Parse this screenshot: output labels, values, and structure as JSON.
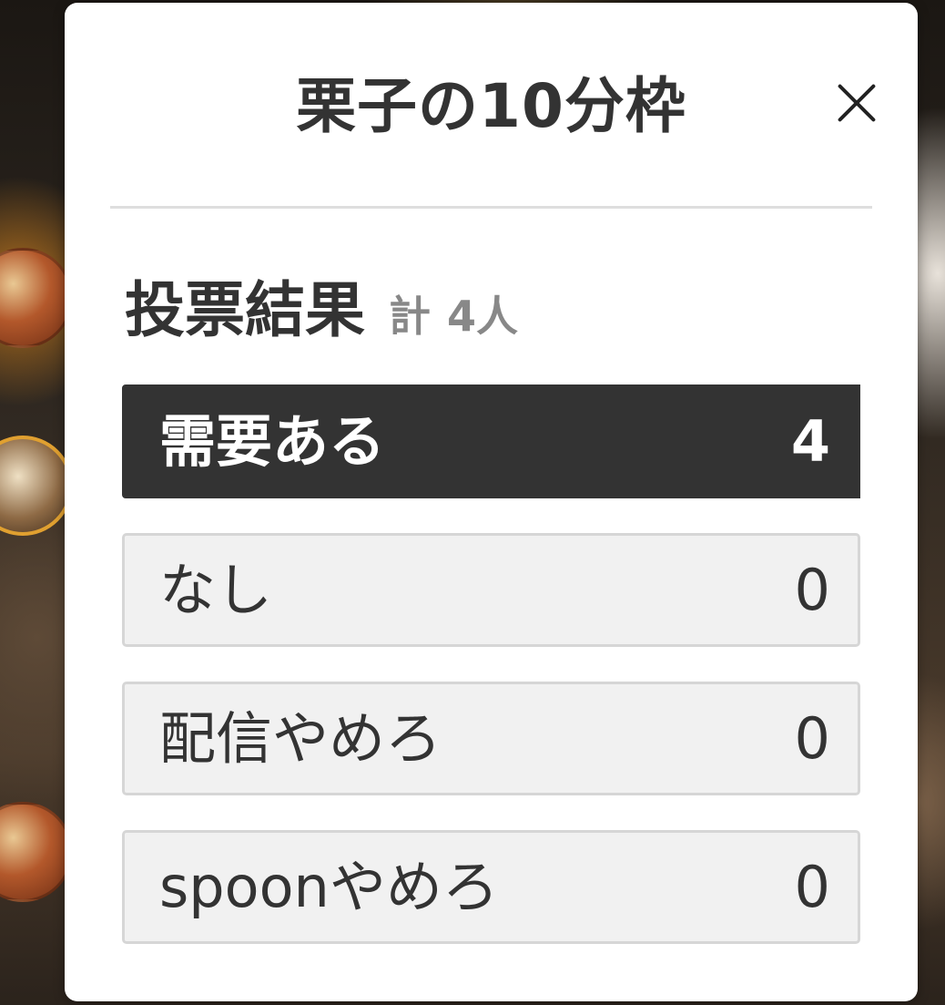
{
  "modal": {
    "title": "栗子の10分枠",
    "close_icon": "close-icon"
  },
  "results": {
    "heading": "投票結果",
    "total_prefix": "計",
    "total_count": "4人"
  },
  "options": [
    {
      "label": "需要ある",
      "count": "4",
      "highlighted": true
    },
    {
      "label": "なし",
      "count": "0",
      "highlighted": false
    },
    {
      "label": "配信やめろ",
      "count": "0",
      "highlighted": false
    },
    {
      "label": "spoonやめろ",
      "count": "0",
      "highlighted": false
    }
  ],
  "colors": {
    "winner_bg": "#333333",
    "option_bg": "#f1f1f1",
    "option_border": "#d6d6d6",
    "text_dark": "#333333",
    "text_muted": "#888888"
  }
}
